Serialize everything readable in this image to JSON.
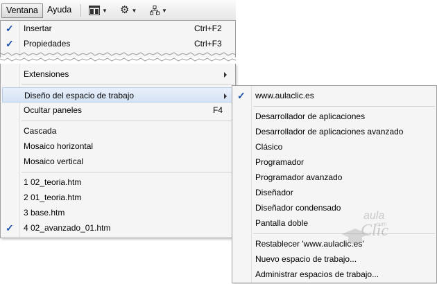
{
  "menubar": {
    "ventana": "Ventana",
    "ayuda": "Ayuda"
  },
  "icons": {
    "layout": "layout-icon",
    "gear": "gear-icon",
    "sitemap": "sitemap-icon"
  },
  "menu_top": {
    "items": [
      {
        "label": "Insertar",
        "shortcut": "Ctrl+F2",
        "checked": true
      },
      {
        "label": "Propiedades",
        "shortcut": "Ctrl+F3",
        "checked": true
      }
    ]
  },
  "menu_main": {
    "extensiones": "Extensiones",
    "diseno": "Diseño del espacio de trabajo",
    "ocultar": "Ocultar paneles",
    "ocultar_shortcut": "F4",
    "cascada": "Cascada",
    "mosaico_h": "Mosaico horizontal",
    "mosaico_v": "Mosaico vertical",
    "recent": [
      {
        "label": "1 02_teoria.htm",
        "checked": false
      },
      {
        "label": "2 01_teoria.htm",
        "checked": false
      },
      {
        "label": "3 base.htm",
        "checked": false
      },
      {
        "label": "4 02_avanzado_01.htm",
        "checked": true
      }
    ]
  },
  "submenu": {
    "current": "www.aulaclic.es",
    "layouts": [
      "Desarrollador de aplicaciones",
      "Desarrollador de aplicaciones avanzado",
      "Clásico",
      "Programador",
      "Programador avanzado",
      "Diseñador",
      "Diseñador condensado",
      "Pantalla doble"
    ],
    "restablecer": "Restablecer 'www.aulaclic.es'",
    "nuevo": "Nuevo espacio de trabajo...",
    "administrar": "Administrar espacios de trabajo..."
  },
  "watermark": {
    "line1": "aula",
    "line2": "Clic",
    "line3": ".com"
  },
  "colors": {
    "check": "#1b4fa8",
    "highlight": "#d5e3f4",
    "menu_bg": "#f5f5f5"
  }
}
